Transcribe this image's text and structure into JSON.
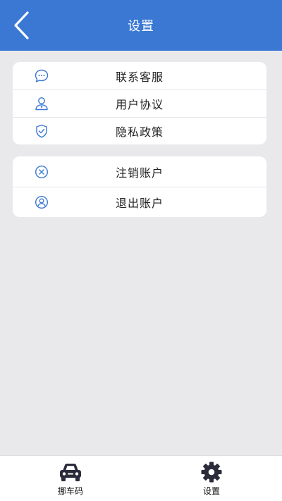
{
  "header": {
    "title": "设置",
    "back_icon": "chevron-left-icon"
  },
  "menu_group_1": [
    {
      "label": "联系客服",
      "icon": "chat-bubble-icon"
    },
    {
      "label": "用户协议",
      "icon": "user-icon"
    },
    {
      "label": "隐私政策",
      "icon": "shield-check-icon"
    }
  ],
  "menu_group_2": [
    {
      "label": "注销账户",
      "icon": "close-circle-icon"
    },
    {
      "label": "退出账户",
      "icon": "user-circle-icon"
    }
  ],
  "tabbar": {
    "tabs": [
      {
        "label": "挪车码",
        "icon": "car-icon"
      },
      {
        "label": "设置",
        "icon": "gear-icon"
      }
    ]
  },
  "colors": {
    "header_bg": "#3a78d4",
    "icon_blue": "#3a78d4",
    "page_bg": "#e9e9ec"
  }
}
